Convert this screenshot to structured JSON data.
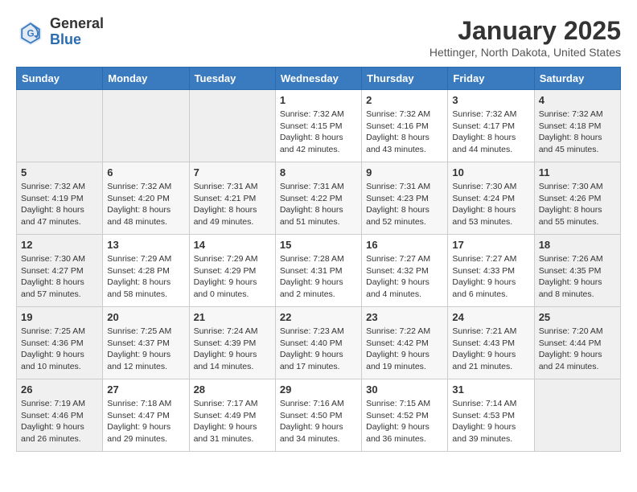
{
  "header": {
    "logo_general": "General",
    "logo_blue": "Blue",
    "month_year": "January 2025",
    "location": "Hettinger, North Dakota, United States"
  },
  "days_of_week": [
    "Sunday",
    "Monday",
    "Tuesday",
    "Wednesday",
    "Thursday",
    "Friday",
    "Saturday"
  ],
  "weeks": [
    {
      "days": [
        {
          "num": "",
          "info": "",
          "type": "empty"
        },
        {
          "num": "",
          "info": "",
          "type": "empty"
        },
        {
          "num": "",
          "info": "",
          "type": "empty"
        },
        {
          "num": "1",
          "info": "Sunrise: 7:32 AM\nSunset: 4:15 PM\nDaylight: 8 hours and 42 minutes.",
          "type": "weekday"
        },
        {
          "num": "2",
          "info": "Sunrise: 7:32 AM\nSunset: 4:16 PM\nDaylight: 8 hours and 43 minutes.",
          "type": "weekday"
        },
        {
          "num": "3",
          "info": "Sunrise: 7:32 AM\nSunset: 4:17 PM\nDaylight: 8 hours and 44 minutes.",
          "type": "weekday"
        },
        {
          "num": "4",
          "info": "Sunrise: 7:32 AM\nSunset: 4:18 PM\nDaylight: 8 hours and 45 minutes.",
          "type": "weekend"
        }
      ]
    },
    {
      "days": [
        {
          "num": "5",
          "info": "Sunrise: 7:32 AM\nSunset: 4:19 PM\nDaylight: 8 hours and 47 minutes.",
          "type": "weekend"
        },
        {
          "num": "6",
          "info": "Sunrise: 7:32 AM\nSunset: 4:20 PM\nDaylight: 8 hours and 48 minutes.",
          "type": "weekday"
        },
        {
          "num": "7",
          "info": "Sunrise: 7:31 AM\nSunset: 4:21 PM\nDaylight: 8 hours and 49 minutes.",
          "type": "weekday"
        },
        {
          "num": "8",
          "info": "Sunrise: 7:31 AM\nSunset: 4:22 PM\nDaylight: 8 hours and 51 minutes.",
          "type": "weekday"
        },
        {
          "num": "9",
          "info": "Sunrise: 7:31 AM\nSunset: 4:23 PM\nDaylight: 8 hours and 52 minutes.",
          "type": "weekday"
        },
        {
          "num": "10",
          "info": "Sunrise: 7:30 AM\nSunset: 4:24 PM\nDaylight: 8 hours and 53 minutes.",
          "type": "weekday"
        },
        {
          "num": "11",
          "info": "Sunrise: 7:30 AM\nSunset: 4:26 PM\nDaylight: 8 hours and 55 minutes.",
          "type": "weekend"
        }
      ]
    },
    {
      "days": [
        {
          "num": "12",
          "info": "Sunrise: 7:30 AM\nSunset: 4:27 PM\nDaylight: 8 hours and 57 minutes.",
          "type": "weekend"
        },
        {
          "num": "13",
          "info": "Sunrise: 7:29 AM\nSunset: 4:28 PM\nDaylight: 8 hours and 58 minutes.",
          "type": "weekday"
        },
        {
          "num": "14",
          "info": "Sunrise: 7:29 AM\nSunset: 4:29 PM\nDaylight: 9 hours and 0 minutes.",
          "type": "weekday"
        },
        {
          "num": "15",
          "info": "Sunrise: 7:28 AM\nSunset: 4:31 PM\nDaylight: 9 hours and 2 minutes.",
          "type": "weekday"
        },
        {
          "num": "16",
          "info": "Sunrise: 7:27 AM\nSunset: 4:32 PM\nDaylight: 9 hours and 4 minutes.",
          "type": "weekday"
        },
        {
          "num": "17",
          "info": "Sunrise: 7:27 AM\nSunset: 4:33 PM\nDaylight: 9 hours and 6 minutes.",
          "type": "weekday"
        },
        {
          "num": "18",
          "info": "Sunrise: 7:26 AM\nSunset: 4:35 PM\nDaylight: 9 hours and 8 minutes.",
          "type": "weekend"
        }
      ]
    },
    {
      "days": [
        {
          "num": "19",
          "info": "Sunrise: 7:25 AM\nSunset: 4:36 PM\nDaylight: 9 hours and 10 minutes.",
          "type": "weekend"
        },
        {
          "num": "20",
          "info": "Sunrise: 7:25 AM\nSunset: 4:37 PM\nDaylight: 9 hours and 12 minutes.",
          "type": "weekday"
        },
        {
          "num": "21",
          "info": "Sunrise: 7:24 AM\nSunset: 4:39 PM\nDaylight: 9 hours and 14 minutes.",
          "type": "weekday"
        },
        {
          "num": "22",
          "info": "Sunrise: 7:23 AM\nSunset: 4:40 PM\nDaylight: 9 hours and 17 minutes.",
          "type": "weekday"
        },
        {
          "num": "23",
          "info": "Sunrise: 7:22 AM\nSunset: 4:42 PM\nDaylight: 9 hours and 19 minutes.",
          "type": "weekday"
        },
        {
          "num": "24",
          "info": "Sunrise: 7:21 AM\nSunset: 4:43 PM\nDaylight: 9 hours and 21 minutes.",
          "type": "weekday"
        },
        {
          "num": "25",
          "info": "Sunrise: 7:20 AM\nSunset: 4:44 PM\nDaylight: 9 hours and 24 minutes.",
          "type": "weekend"
        }
      ]
    },
    {
      "days": [
        {
          "num": "26",
          "info": "Sunrise: 7:19 AM\nSunset: 4:46 PM\nDaylight: 9 hours and 26 minutes.",
          "type": "weekend"
        },
        {
          "num": "27",
          "info": "Sunrise: 7:18 AM\nSunset: 4:47 PM\nDaylight: 9 hours and 29 minutes.",
          "type": "weekday"
        },
        {
          "num": "28",
          "info": "Sunrise: 7:17 AM\nSunset: 4:49 PM\nDaylight: 9 hours and 31 minutes.",
          "type": "weekday"
        },
        {
          "num": "29",
          "info": "Sunrise: 7:16 AM\nSunset: 4:50 PM\nDaylight: 9 hours and 34 minutes.",
          "type": "weekday"
        },
        {
          "num": "30",
          "info": "Sunrise: 7:15 AM\nSunset: 4:52 PM\nDaylight: 9 hours and 36 minutes.",
          "type": "weekday"
        },
        {
          "num": "31",
          "info": "Sunrise: 7:14 AM\nSunset: 4:53 PM\nDaylight: 9 hours and 39 minutes.",
          "type": "weekday"
        },
        {
          "num": "",
          "info": "",
          "type": "empty"
        }
      ]
    }
  ]
}
